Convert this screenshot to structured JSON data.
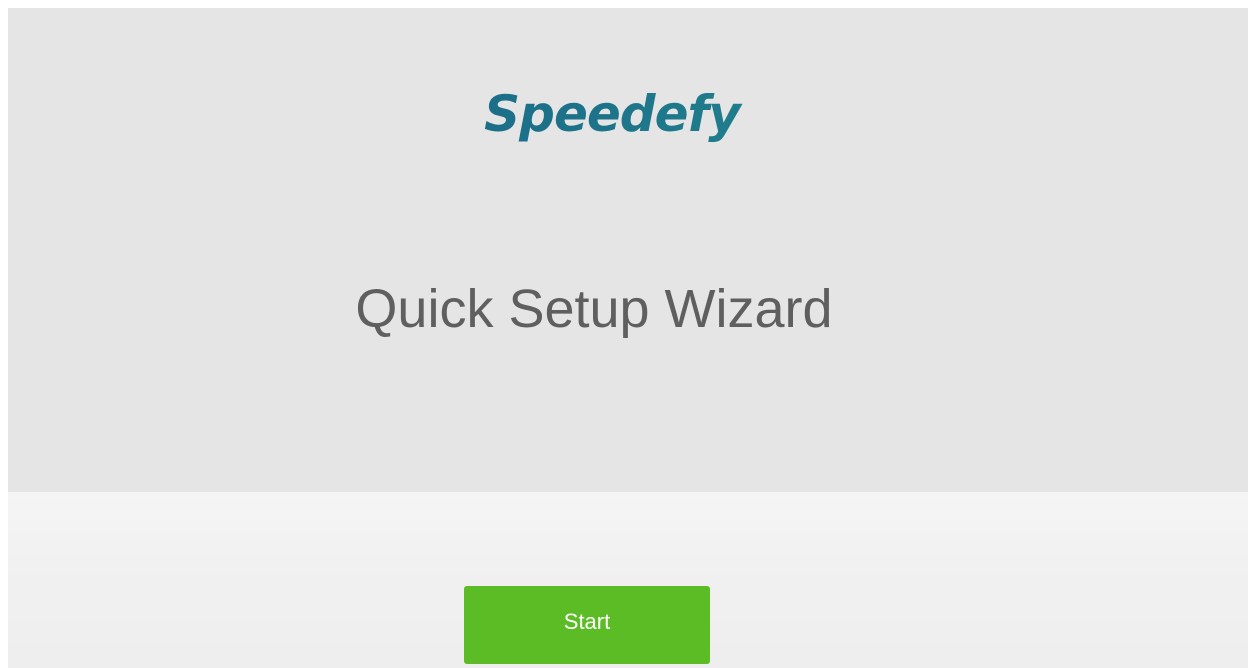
{
  "brand": {
    "logo_text": "Speedefy",
    "logo_colors": [
      "#1a5f8a",
      "#2a9a93"
    ]
  },
  "wizard": {
    "title": "Quick Setup Wizard",
    "start_label": "Start",
    "start_button_color": "#5bbc25"
  }
}
